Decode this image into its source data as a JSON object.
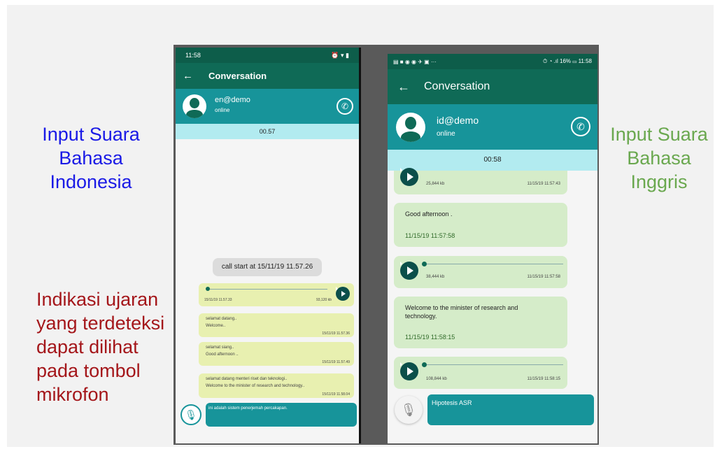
{
  "captions": {
    "left_top": "Input Suara Bahasa Indonesia",
    "right_top": "Input Suara Bahasa Inggris",
    "left_bottom": "Indikasi ujaran yang terdeteksi dapat dilihat pada tombol mikrofon"
  },
  "phone1": {
    "status_time": "11:58",
    "title": "Conversation",
    "contact_name": "en@demo",
    "contact_status": "online",
    "timer": "00.57",
    "call_start": "call start at 15/11/19 11.57.26",
    "audio": {
      "time": "15/11/19 11.57.33",
      "size": "93,120 kb"
    },
    "messages": [
      {
        "heading": "selamat datang..",
        "translation": "Welcome..",
        "time": "15/11/19 11.57.36"
      },
      {
        "heading": "selamat siang..",
        "translation": "Good afternoon ..",
        "time": "15/11/19 11.57.49"
      },
      {
        "heading": "selamat datang menteri riset dan teknologi..",
        "translation": "Welcome to the minister of research and technology..",
        "time": "15/11/19 11.58.04"
      }
    ],
    "input_text": "ini adalah sistem penerjemah percakapan."
  },
  "phone2": {
    "status_battery": "16%",
    "status_time": "11:58",
    "title": "Conversation",
    "contact_name": "id@demo",
    "contact_status": "online",
    "timer": "00:58",
    "audio_top": {
      "size": "25,844 kb",
      "time": "11/15/19 11:57:43"
    },
    "msg1": {
      "text": "Good afternoon .",
      "time": "11/15/19 11:57:58"
    },
    "audio_mid": {
      "size": "38,444 kb",
      "time": "11/15/19 11:57:58"
    },
    "msg2": {
      "text": "Welcome to the minister of research and technology.",
      "time": "11/15/19 11:58:15"
    },
    "audio_bot": {
      "size": "108,844 kb",
      "time": "11/15/19 11:58:15"
    },
    "input_text": "Hipotesis ASR"
  }
}
